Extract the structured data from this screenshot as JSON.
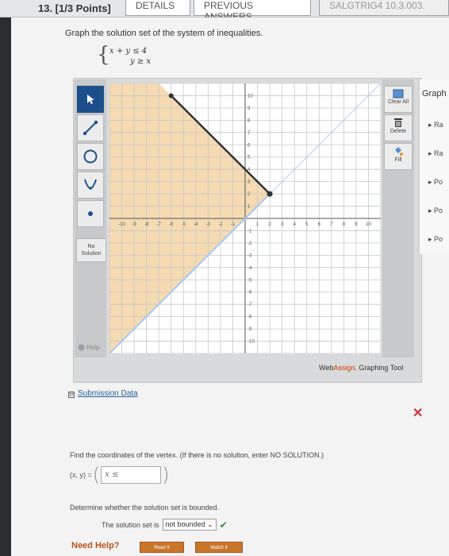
{
  "header": {
    "question_number": "13. [1/3 Points]",
    "tab_details": "DETAILS",
    "tab_previous": "PREVIOUS ANSWERS",
    "tab_solution": "SALGTRIG4 10.3.003."
  },
  "question": {
    "prompt": "Graph the solution set of the system of inequalities.",
    "ineq1": "x + y ≤ 4",
    "ineq2": "y ≥ x"
  },
  "tool": {
    "no_solution": "No Solution",
    "help": "Help",
    "clear_all": "Clear All",
    "delete": "Delete",
    "fill": "Fill",
    "brand_prefix": "Web",
    "brand_accent": "Assign",
    "brand_suffix": ". Graphing Tool",
    "x_ticks": [
      "-10",
      "-9",
      "-8",
      "-7",
      "-6",
      "-5",
      "-4",
      "-3",
      "-2",
      "-1",
      "1",
      "2",
      "3",
      "4",
      "5",
      "6",
      "7",
      "8",
      "9",
      "10"
    ],
    "y_ticks": [
      "10",
      "9",
      "8",
      "7",
      "6",
      "5",
      "4",
      "3",
      "2",
      "1",
      "-1",
      "-2",
      "-3",
      "-4",
      "-5",
      "-6",
      "-7",
      "-8",
      "-9",
      "-10"
    ]
  },
  "graph_panel": {
    "title": "Graph",
    "items": [
      "Ra",
      "Ra",
      "Po",
      "Po",
      "Po"
    ]
  },
  "submission": {
    "label": "Submission Data",
    "toggle": "⊟"
  },
  "vertex": {
    "question": "Find the coordinates of the vertex. (If there is no solution, enter NO SOLUTION.)",
    "label": "(x, y) =",
    "input_value": "x ≤"
  },
  "bounded": {
    "question": "Determine whether the solution set is bounded.",
    "label": "The solution set is",
    "selected": "not bounded"
  },
  "help": {
    "need_help": "Need Help?",
    "read_it": "Read It",
    "watch_it": "Watch It"
  },
  "colors": {
    "shade": "#f3d3a4",
    "boundary_solid": "#333333",
    "boundary_dashed": "#a9c7e8",
    "accent": "#1c4e8a"
  }
}
